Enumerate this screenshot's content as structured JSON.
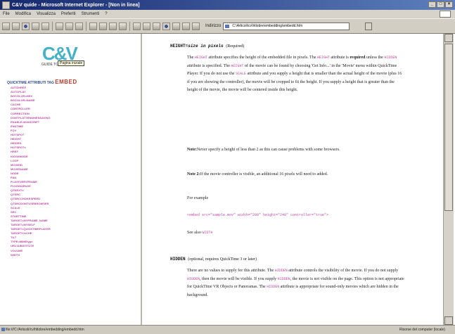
{
  "window": {
    "title": "C&V quide - Microsoft Internet Explorer - [Non in linea]"
  },
  "menubar": {
    "items": [
      "File",
      "Modifica",
      "Visualizza",
      "Preferiti",
      "Strumenti",
      "?"
    ]
  },
  "toolbar": {
    "address_label": "Indirizzo",
    "address_value": "C:\\Articoli\\cv\\htlobre\\embedding\\embedd.htm"
  },
  "sidebar": {
    "logo_text": "C&V",
    "logo_subtitle": "GUIDE TO",
    "tooltip": "Pagina iniziale",
    "quick_label": "QUICKTIME ATTRIBUTI TAG",
    "quick_tag": "EMBED",
    "attributes": [
      "AUTOHREF",
      "AUTOPLAY",
      "BGCOLOR=HEX",
      "BGCOLOR=NAME",
      "CACHE",
      "CONTROLLER",
      "CORRECTION",
      "DONTFLATTENWHENSAVING",
      "ENABLEJAVASCRIPT",
      "ENDTIME",
      "FOV",
      "HOTSPOT",
      "HEIGHT",
      "HIDDEN",
      "HOTSPOTn",
      "HREF",
      "KIOSKMODE",
      "LOOP",
      "MOVIEID",
      "MOVIENAME",
      "NODE",
      "PAN",
      "PLAYEVERYFRAME",
      "PLUGINSPAGE",
      "QTNEXTn",
      "QTSRC",
      "QTSRCCHOKESPEED",
      "QTSRCDONTUSEBROWSER",
      "SCALE",
      "SRC",
      "STARTTIME",
      "TARGET=MYFRAME_NAME",
      "TARGET=MYSELF",
      "TARGET=QUICKTIMEPLAYER",
      "TARGETCACHE",
      "TILT",
      "TYPE=MIMEtype",
      "URLSUBSTITUTE",
      "VOLUME",
      "WIDTH"
    ]
  },
  "main": {
    "height_head": "HEIGHT=",
    "height_head_em": "size in pixels",
    "height_head_tail": "(Required)",
    "p1": {
      "a": "The ",
      "kw1": "HEIGHT",
      "b": " attribute specifies the height of the embedded file in pixels. The ",
      "kw2": "HEIGHT",
      "c": " attribute is ",
      "strong": "required",
      "d": " unless the ",
      "kw3": "HIDDEN",
      "e": " attribute is specified. The ",
      "kw4": "HEIGHT",
      "f": " of the movie can be found by choosing 'Get Info...' in the 'Movie' menu within QuickTime Player. If you do not use the ",
      "kw5": "SCALE",
      "g": " attribute and you supply a height that is smaller than the actual height of the movie (plus 16 if you are showing the controller), the movie will be cropped to fit the height. If you supply a height that is greater than the height of the movie, the movie will be centered inside this height."
    },
    "note1_label": "Note:",
    "note1_text": "Never specify a height of less than 2 as this can cause problems with some browsers.",
    "note2_label": "Note 2:",
    "note2_text": "If the movie controller is visible, an additional 16 pixels will need to added.",
    "example_label": "For example",
    "example_code": "<embed src=\"sample.mov\" width=\"200\" height=\"240\" controller=\"true\">",
    "see_also": "See also ",
    "see_also_kw": "WIDTH",
    "hidden_head": "HIDDEN",
    "hidden_head_tail": "(optional, requires QuickTime 3 or later)",
    "p2": {
      "a": "There are no values to supply for this attribute. The ",
      "kw1": "HIDDEN",
      "b": " attribute controls the visibility of the movie. If you do not supply ",
      "kw2": "HIDDEN",
      "c": ", then the movie will be visible. If you supply ",
      "kw3": "HIDDEN",
      "d": ", the movie is not visible on the page. This option is not appropriate for QuickTime VR Objects or Panoramas. The ",
      "kw4": "HIDDEN",
      "e": " attribute is appropriate for sound-only movies which are hidden in the background."
    }
  },
  "statusbar": {
    "left": "file:///C:/Articoli/cv/htlobre/embedding/embedd.htm",
    "right": "Risorse del computer (locale)"
  },
  "colors": {
    "accent_title": "#16286e",
    "link_magenta": "#c04aa3",
    "embed_red": "#c13a2c",
    "logo_cyan": "#43b2c9"
  }
}
